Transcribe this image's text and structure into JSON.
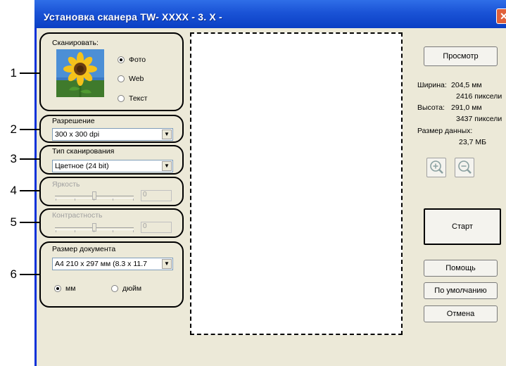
{
  "window": {
    "title": "Установка сканера TW- XXXX   - 3. X -",
    "close": "✕"
  },
  "callouts": [
    "1",
    "2",
    "3",
    "4",
    "5",
    "6"
  ],
  "scan": {
    "label": "Сканировать:",
    "options": [
      "Фото",
      "Web",
      "Текст"
    ],
    "selected": "Фото"
  },
  "resolution": {
    "label": "Разрешение",
    "value": "300 x 300 dpi"
  },
  "scan_type": {
    "label": "Тип сканирования",
    "value": "Цветное (24 bit)"
  },
  "brightness": {
    "label": "Яркость",
    "value": "0",
    "level": 0.5
  },
  "contrast": {
    "label": "Контрастность",
    "value": "0",
    "level": 0.5
  },
  "doc_size": {
    "label": "Размер документа",
    "value": "A4 210 x 297 мм (8.3 x 11.7",
    "units": [
      "мм",
      "дюйм"
    ],
    "selected_unit": "мм"
  },
  "right_panel": {
    "preview_button": "Просмотр",
    "width_label": "Ширина:",
    "width_mm": "204,5 мм",
    "width_px": "2416 пиксели",
    "height_label": "Высота:",
    "height_mm": "291,0 мм",
    "height_px": "3437 пиксели",
    "data_size_label": "Размер данных:",
    "data_size": "23,7 МБ",
    "zoom_in_icon": "zoom-in-icon",
    "zoom_out_icon": "zoom-out-icon",
    "start_button": "Старт",
    "help_button": "Помощь",
    "default_button": "По умолчанию",
    "cancel_button": "Отмена"
  },
  "colors": {
    "titlebar": "#1a53d6",
    "window_bg": "#ece9d8",
    "border": "#0831d9"
  }
}
